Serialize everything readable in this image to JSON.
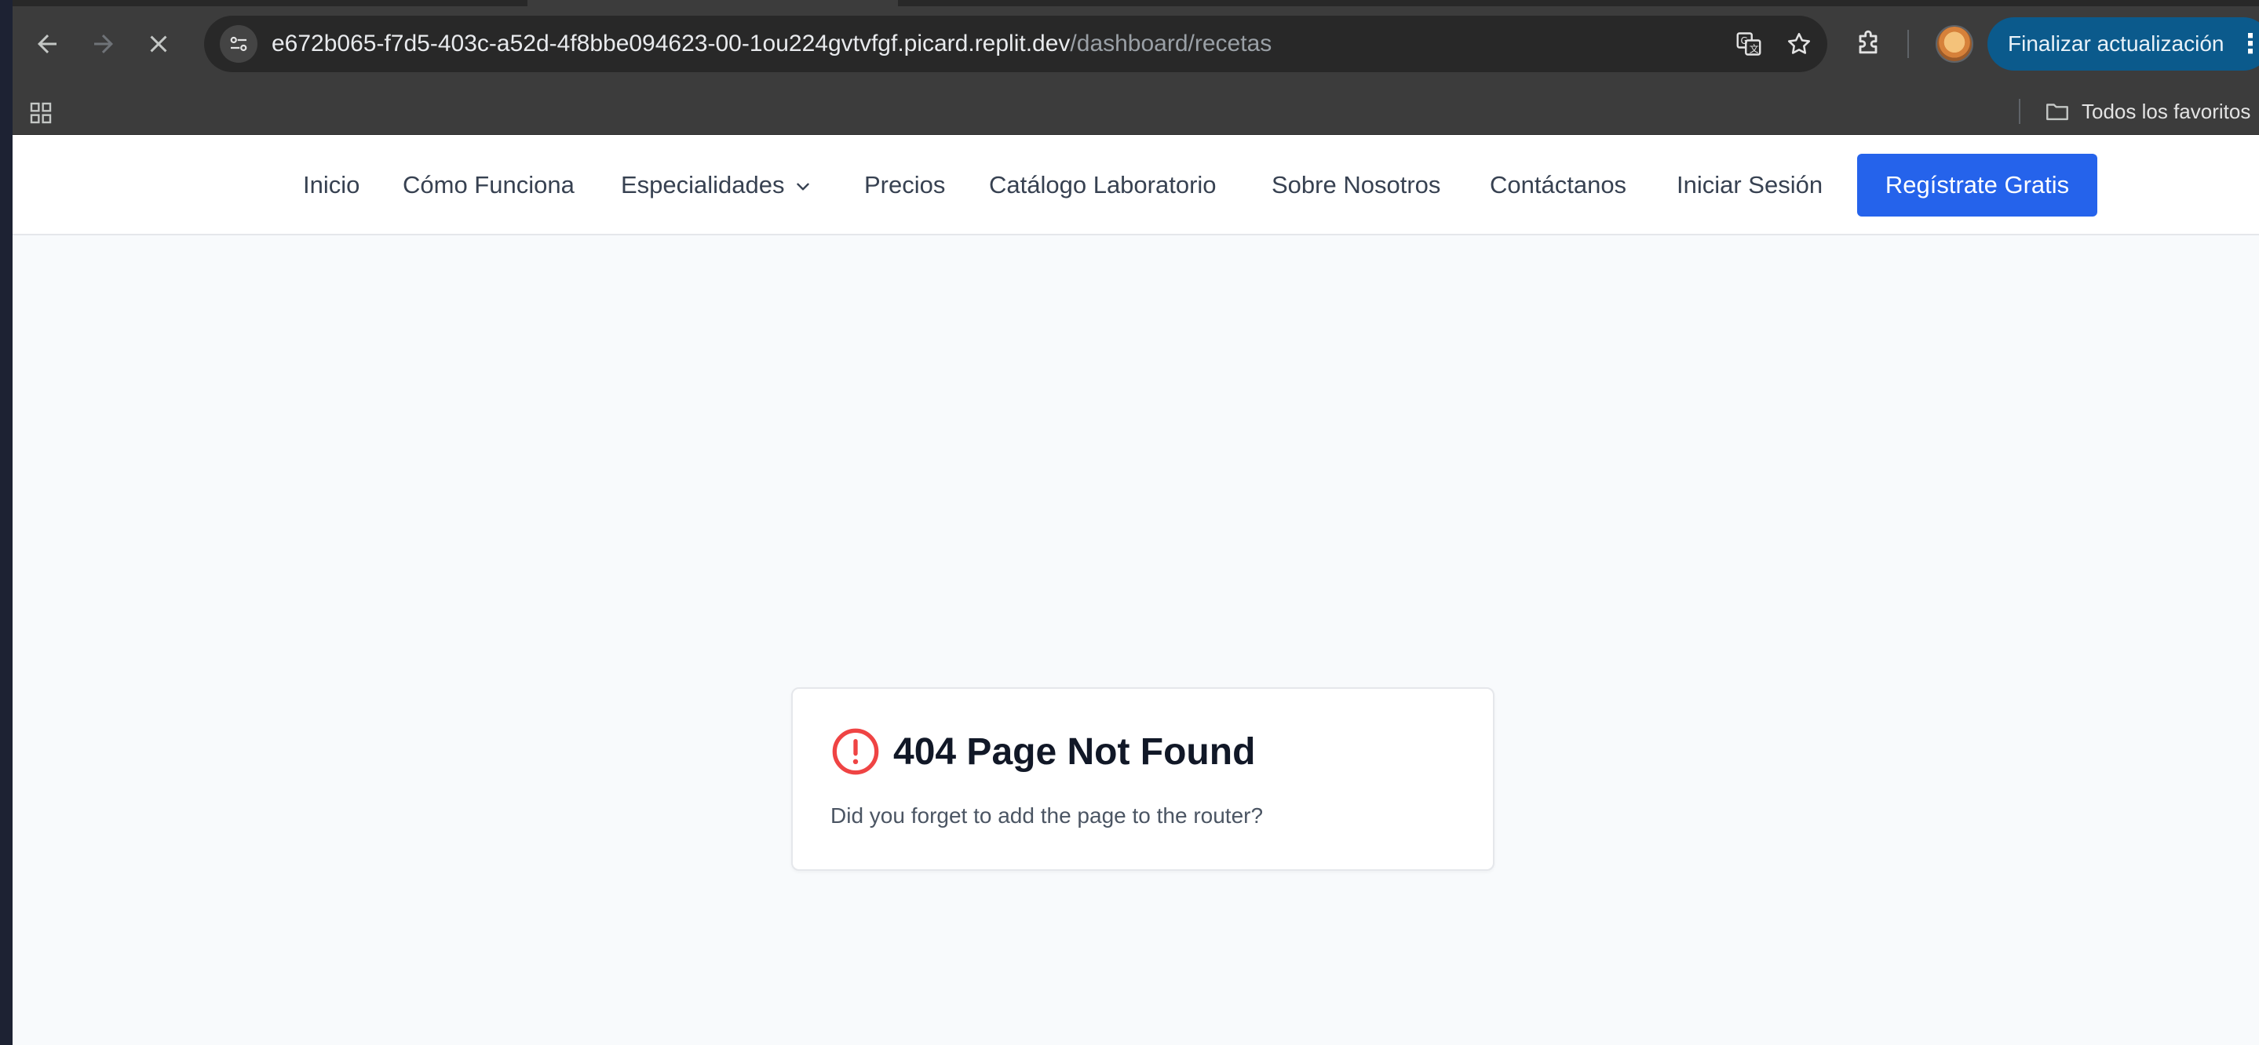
{
  "browser": {
    "url_host": "e672b065-f7d5-403c-a52d-4f8bbe094623-00-1ou224gvtvfgf.picard.replit.dev",
    "url_path": "/dashboard/recetas",
    "update_button_label": "Finalizar actualización",
    "all_bookmarks_label": "Todos los favoritos",
    "icons": {
      "back": "arrow-left-icon",
      "forward": "arrow-right-icon",
      "stop": "close-icon",
      "site_info": "tune-icon",
      "translate": "translate-icon",
      "bookmark": "star-icon",
      "extensions": "puzzle-icon",
      "menu": "more-vert-icon",
      "apps": "apps-grid-icon",
      "folder": "folder-icon"
    }
  },
  "site_nav": {
    "items": [
      {
        "label": "Inicio"
      },
      {
        "label": "Cómo Funciona"
      },
      {
        "label": "Especialidades",
        "has_dropdown": true
      },
      {
        "label": "Precios"
      },
      {
        "label": "Catálogo Laboratorio"
      },
      {
        "label": "Sobre Nosotros"
      },
      {
        "label": "Contáctanos"
      },
      {
        "label": "Iniciar Sesión"
      }
    ],
    "cta_label": "Regístrate Gratis"
  },
  "error_card": {
    "title": "404 Page Not Found",
    "message": "Did you forget to add the page to the router?",
    "icon": "alert-circle-icon"
  },
  "colors": {
    "cta": "#2563eb",
    "error_icon": "#ef4444",
    "update_button": "#0b5a8c"
  }
}
